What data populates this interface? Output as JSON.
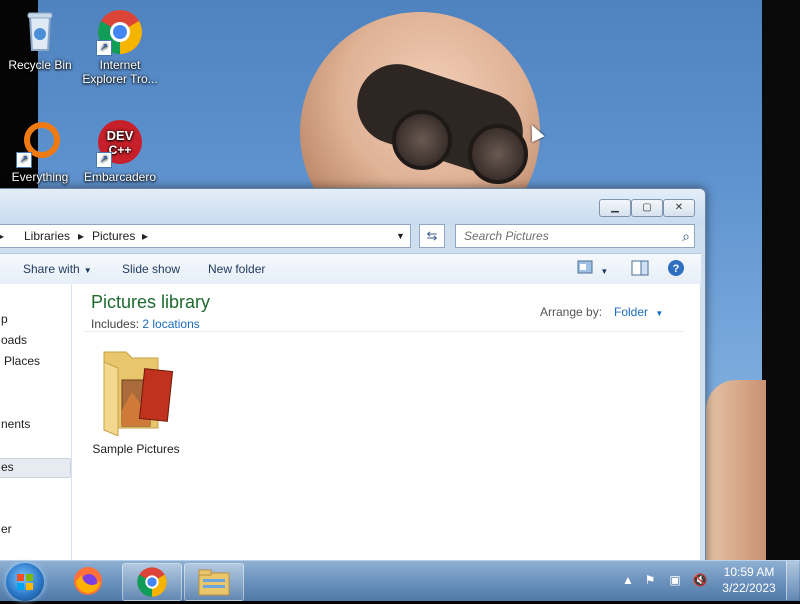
{
  "desktop": {
    "icons": [
      {
        "label": "Recycle Bin",
        "icon": "recycle-bin-icon"
      },
      {
        "label": "Internet Explorer Tro...",
        "icon": "chrome-icon"
      },
      {
        "label": "Everything",
        "icon": "everything-icon"
      },
      {
        "label": "Embarcadero",
        "icon": "dev-cpp-icon"
      }
    ]
  },
  "window": {
    "breadcrumb": [
      "Libraries",
      "Pictures"
    ],
    "search_placeholder": "Search Pictures",
    "commands": {
      "share_with": "Share with",
      "slide_show": "Slide show",
      "new_folder": "New folder"
    },
    "nav_items": [
      "p",
      "oads",
      "Places",
      "nents",
      "es",
      "er"
    ],
    "library_title": "Pictures library",
    "includes_label": "Includes:",
    "includes_link": "2 locations",
    "arrange_label": "Arrange by:",
    "arrange_value": "Folder",
    "items": [
      {
        "label": "Sample Pictures",
        "icon": "pictures-folder-icon"
      }
    ]
  },
  "taskbar": {
    "pinned": [
      "start-orb",
      "firefox-icon",
      "chrome-icon",
      "explorer-icon"
    ],
    "time": "10:59 AM",
    "date": "3/22/2023"
  },
  "colors": {
    "title_green": "#1e6a2e",
    "link_blue": "#1b6bbf"
  }
}
